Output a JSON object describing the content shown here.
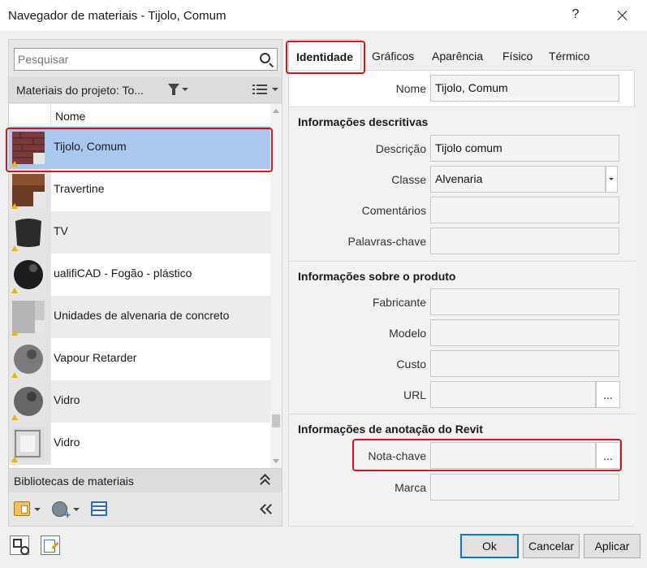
{
  "window": {
    "title": "Navegador de materiais - Tijolo, Comum",
    "help": "?"
  },
  "search": {
    "placeholder": "Pesquisar",
    "value": ""
  },
  "project": {
    "header": "Materiais do projeto: To..."
  },
  "grid": {
    "column_name": "Nome",
    "rows": [
      {
        "label": "Tijolo, Comum"
      },
      {
        "label": "Travertine"
      },
      {
        "label": "TV"
      },
      {
        "label": "ualifiCAD - Fogão - plástico"
      },
      {
        "label": "Unidades de alvenaria de concreto"
      },
      {
        "label": "Vapour Retarder"
      },
      {
        "label": "Vidro"
      },
      {
        "label": "Vidro"
      }
    ]
  },
  "libraries": {
    "header": "Bibliotecas de materiais"
  },
  "tabs": [
    "Identidade",
    "Gráficos",
    "Aparência",
    "Físico",
    "Térmico"
  ],
  "identity": {
    "name_label": "Nome",
    "name_value": "Tijolo, Comum",
    "section_descriptive": "Informações descritivas",
    "description_label": "Descrição",
    "description_value": "Tijolo comum",
    "class_label": "Classe",
    "class_value": "Alvenaria",
    "comments_label": "Comentários",
    "comments_value": "",
    "keywords_label": "Palavras-chave",
    "keywords_value": "",
    "section_product": "Informações sobre o produto",
    "manufacturer_label": "Fabricante",
    "manufacturer_value": "",
    "model_label": "Modelo",
    "model_value": "",
    "cost_label": "Custo",
    "cost_value": "",
    "url_label": "URL",
    "url_value": "",
    "browse": "...",
    "section_revit": "Informações de anotação do Revit",
    "keynote_label": "Nota-chave",
    "keynote_value": "",
    "mark_label": "Marca",
    "mark_value": ""
  },
  "buttons": {
    "ok": "Ok",
    "cancel": "Cancelar",
    "apply": "Aplicar"
  },
  "colors": {
    "selection": "#a9c8ee",
    "highlight": "#d0191f",
    "primary_border": "#0078d7"
  }
}
